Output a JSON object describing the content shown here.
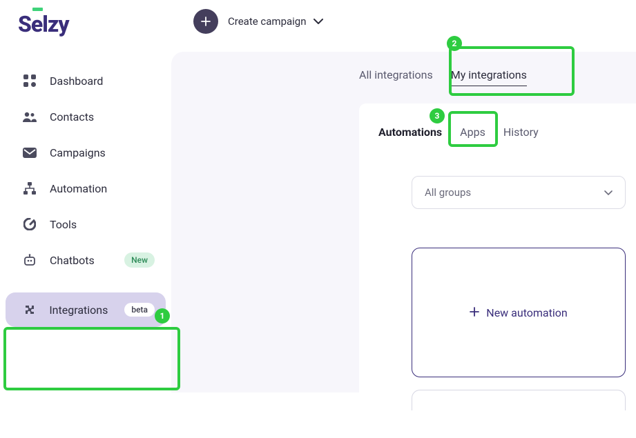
{
  "brand": "Selzy",
  "create_campaign_label": "Create campaign",
  "sidebar": {
    "items": [
      {
        "label": "Dashboard"
      },
      {
        "label": "Contacts"
      },
      {
        "label": "Campaigns"
      },
      {
        "label": "Automation"
      },
      {
        "label": "Tools"
      },
      {
        "label": "Chatbots",
        "badge": "New"
      },
      {
        "label": "Integrations",
        "badge": "beta",
        "active": true
      }
    ]
  },
  "top_tabs": {
    "all": "All integrations",
    "my": "My integrations"
  },
  "sub_tabs": {
    "automations": "Automations",
    "apps": "Apps",
    "history": "History"
  },
  "dropdown": {
    "selected": "All groups"
  },
  "new_automation_label": "New automation",
  "callouts": {
    "n1": "1",
    "n2": "2",
    "n3": "3"
  }
}
